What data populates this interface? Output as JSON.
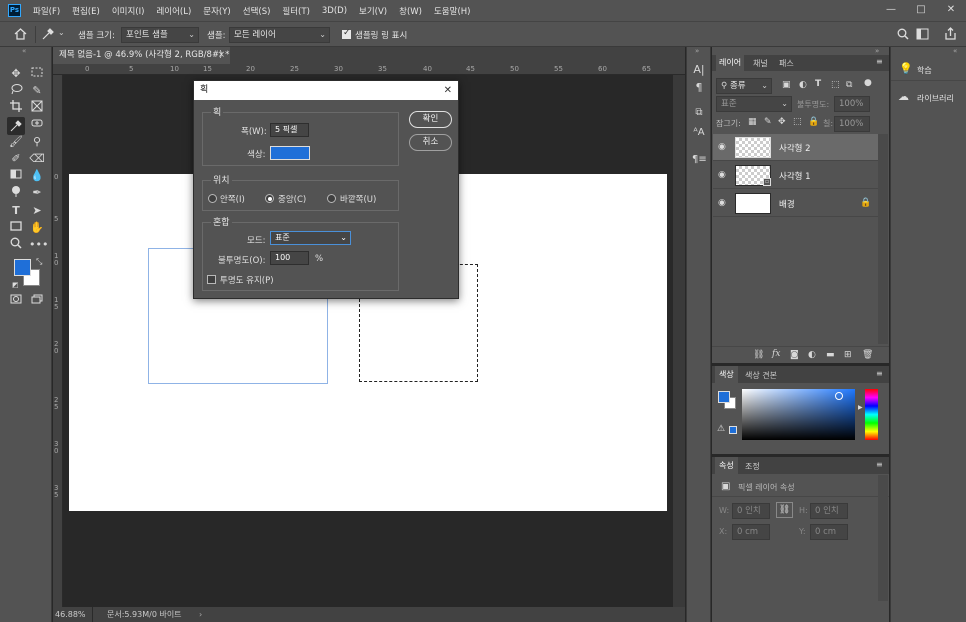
{
  "app": {
    "logo": "Ps"
  },
  "menu": [
    "파일(F)",
    "편집(E)",
    "이미지(I)",
    "레이어(L)",
    "문자(Y)",
    "선택(S)",
    "필터(T)",
    "3D(D)",
    "보기(V)",
    "창(W)",
    "도움말(H)"
  ],
  "window_controls": {
    "minimize": "—",
    "maximize": "□",
    "close": "✕"
  },
  "options_bar": {
    "home_icon": "home-icon",
    "tool_icon": "eyedropper-icon",
    "sample_size_label": "샘플 크기:",
    "sample_size_value": "포인트 샘플",
    "sample_label": "샘플:",
    "sample_value": "모든 레이어",
    "show_ring_label": "샘플링 링 표시"
  },
  "document": {
    "tab_title": "제목 없음-1 @ 46.9% (사각형 2, RGB/8#) *",
    "close": "×",
    "zoom": "46.88%",
    "doc_size": "문서:5.93M/0 바이트",
    "ruler_h": [
      "0",
      "5",
      "10",
      "15",
      "20",
      "25",
      "30",
      "35",
      "40",
      "45",
      "50",
      "55",
      "60",
      "65"
    ],
    "ruler_v": [
      "0",
      "5",
      "1 0",
      "1 5",
      "2 0",
      "2 5",
      "3 0",
      "3 5"
    ]
  },
  "dialog": {
    "title": "획",
    "close": "✕",
    "stroke_group": "획",
    "width_label": "폭(W):",
    "width_value": "5 픽셀",
    "color_label": "색상:",
    "color_value": "#1f6fd8",
    "location_group": "위치",
    "inside": "안쪽(I)",
    "center": "중앙(C)",
    "outside": "바깥쪽(U)",
    "blend_group": "혼합",
    "mode_label": "모드:",
    "mode_value": "표준",
    "opacity_label": "불투명도(O):",
    "opacity_value": "100",
    "opacity_unit": "%",
    "preserve_label": "투명도 유지(P)",
    "ok": "확인",
    "cancel": "취소"
  },
  "layers_panel": {
    "tabs": [
      "레이어",
      "채널",
      "패스"
    ],
    "kind_filter": "종류",
    "blend_mode": "표준",
    "opacity_label": "불투명도:",
    "opacity_value": "100%",
    "lock_label": "잠그기:",
    "fill_label": "칠:",
    "fill_value": "100%",
    "layers": [
      {
        "name": "사각형 2",
        "selected": true
      },
      {
        "name": "사각형 1",
        "selected": false
      },
      {
        "name": "배경",
        "selected": false
      }
    ],
    "bottom_icons": [
      "link-icon",
      "fx-icon",
      "mask-icon",
      "adjustment-icon",
      "folder-icon",
      "new-layer-icon",
      "trash-icon"
    ]
  },
  "color_panel": {
    "tabs": [
      "색상",
      "색상 견본"
    ],
    "foreground": "#1f6fd8",
    "background": "#ffffff"
  },
  "properties_panel": {
    "tabs": [
      "속성",
      "조정"
    ],
    "heading": "픽셀 레이어 속성",
    "w_label": "W:",
    "w_value": "0 인치",
    "h_label": "H:",
    "h_value": "0 인치",
    "x_label": "X:",
    "x_value": "0 cm",
    "y_label": "Y:",
    "y_value": "0 cm"
  },
  "learn_panel": {
    "learn": "학습",
    "libraries": "라이브러리"
  }
}
